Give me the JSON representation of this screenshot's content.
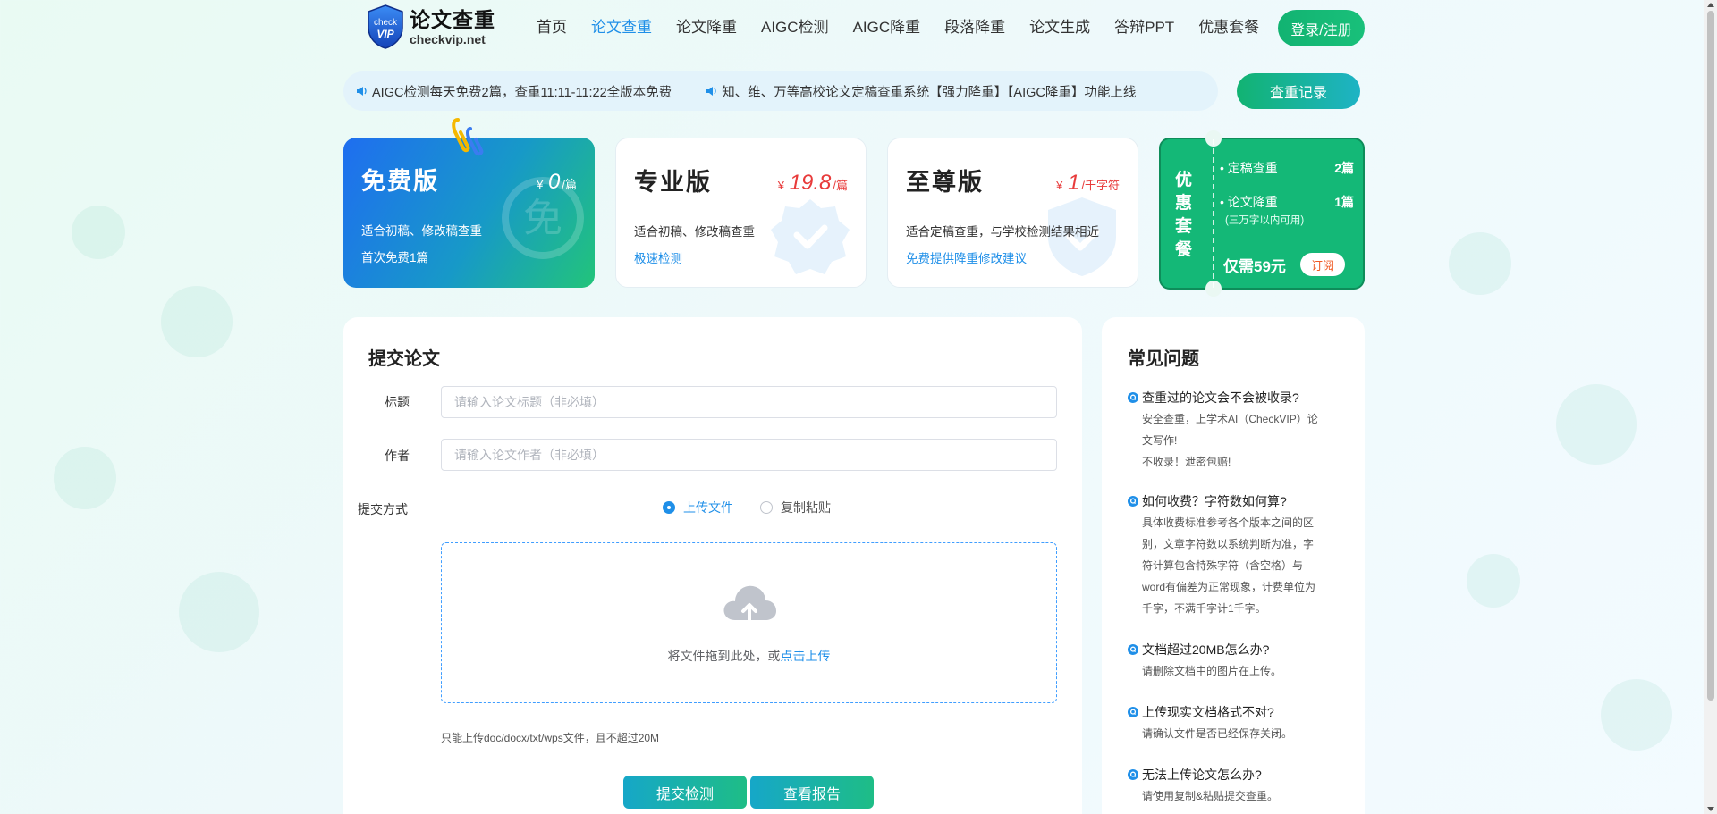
{
  "header": {
    "logo_title": "论文查重",
    "logo_domain": "checkvip.net",
    "logo_badge_top": "check",
    "logo_badge_bottom": "VIP",
    "nav": [
      "首页",
      "论文查重",
      "论文降重",
      "AIGC检测",
      "AIGC降重",
      "段落降重",
      "论文生成",
      "答辩PPT",
      "优惠套餐"
    ],
    "active_nav": "论文查重",
    "login_label": "登录/注册"
  },
  "notice": {
    "items": [
      "AIGC检测每天免费2篇，查重11:11-11:22全版本免费",
      "知、维、万等高校论文定稿查重系统【强力降重】【AIGC降重】功能上线"
    ],
    "record_label": "查重记录"
  },
  "plans": {
    "free": {
      "name": "免费版",
      "currency": "¥",
      "price": "0",
      "unit": "/篇",
      "desc": "适合初稿、修改稿查重",
      "extra": "首次免费1篇",
      "watermark": "免"
    },
    "pro": {
      "name": "专业版",
      "currency": "¥",
      "price": "19.8",
      "unit": "/篇",
      "desc": "适合初稿、修改稿查重",
      "link": "极速检测"
    },
    "ultimate": {
      "name": "至尊版",
      "currency": "¥",
      "price": "1",
      "unit": "/千字符",
      "desc": "适合定稿查重，与学校检测结果相近",
      "link": "免费提供降重修改建议"
    },
    "combo": {
      "vertical_title": "优惠套餐",
      "item1_label": "定稿查重",
      "item1_count": "2篇",
      "item2_label": "论文降重",
      "item2_count": "1篇",
      "item2_note": "(三万字以内可用)",
      "price": "仅需59元",
      "subscribe_label": "订阅"
    }
  },
  "submit": {
    "title": "提交论文",
    "title_label": "标题",
    "title_placeholder": "请输入论文标题（非必填）",
    "title_value": "",
    "author_label": "作者",
    "author_placeholder": "请输入论文作者（非必填）",
    "author_value": "",
    "method_label": "提交方式",
    "method_upload": "上传文件",
    "method_paste": "复制粘贴",
    "upload_text": "将文件拖到此处，或",
    "upload_link": "点击上传",
    "upload_tip": "只能上传doc/docx/txt/wps文件，且不超过20M",
    "submit_label": "提交检测",
    "report_label": "查看报告"
  },
  "faq": {
    "title": "常见问题",
    "items": [
      {
        "q": "查重过的论文会不会被收录?",
        "a": [
          "安全查重，上学术AI（CheckVIP）论",
          "文写作!",
          "不收录！泄密包赔!"
        ]
      },
      {
        "q": "如何收费？字符数如何算?",
        "a": [
          "具体收费标准参考各个版本之间的区",
          "别，文章字符数以系统判断为准，字",
          "符计算包含特殊字符（含空格）与",
          "word有偏差为正常现象，计费单位为",
          "千字，不满千字计1千字。"
        ]
      },
      {
        "q": "文档超过20MB怎么办?",
        "a": [
          "请删除文档中的图片在上传。"
        ]
      },
      {
        "q": "上传现实文档格式不对?",
        "a": [
          "请确认文件是否已经保存关闭。"
        ]
      },
      {
        "q": "无法上传论文怎么办?",
        "a": [
          "请使用复制&粘贴提交查重。"
        ]
      }
    ]
  },
  "colors": {
    "accent": "#1f8fe8",
    "brand_green": "#14b877",
    "price_red": "#e83b3b"
  }
}
